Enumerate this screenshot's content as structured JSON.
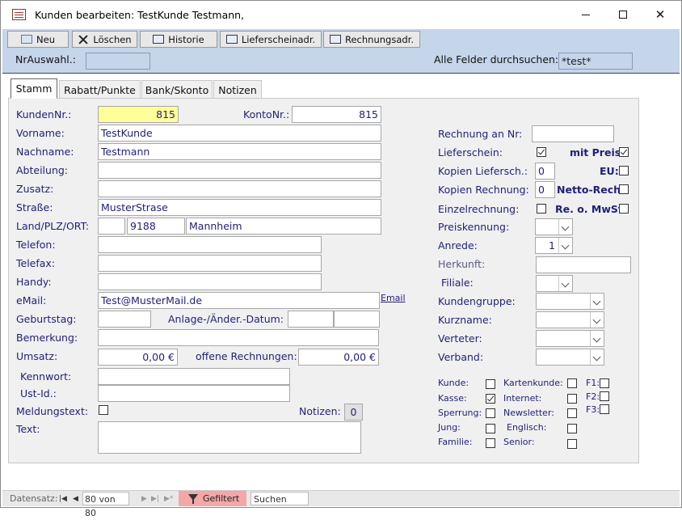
{
  "window": {
    "title": "Kunden bearbeiten: TestKunde Testmann,"
  },
  "toolbar": {
    "neu": "Neu",
    "loeschen": "Löschen",
    "historie": "Historie",
    "lieferscheinadr": "Lieferscheinadr.",
    "rechnungsadr": "Rechnungsadr."
  },
  "header": {
    "nr_auswahl_label": "NrAuswahl.:",
    "nr_auswahl_value": "",
    "search_label": "Alle Felder durchsuchen:",
    "search_value": "*test*"
  },
  "tabs": [
    "Stamm",
    "Rabatt/Punkte",
    "Bank/Skonto",
    "Notizen"
  ],
  "left": {
    "kundennr_label": "KundenNr.:",
    "kundennr": "815",
    "kontonr_label": "KontoNr.:",
    "kontonr": "815",
    "vorname_label": "Vorname:",
    "vorname": "TestKunde",
    "nachname_label": "Nachname:",
    "nachname": "Testmann",
    "abteilung_label": "Abteilung:",
    "abteilung": "",
    "zusatz_label": "Zusatz:",
    "zusatz": "",
    "strasse_label": "Straße:",
    "strasse": "MusterStrase",
    "land_label": "Land/PLZ/ORT:",
    "land": "",
    "plz": "9188",
    "ort": "Mannheim",
    "telefon_label": "Telefon:",
    "telefon": "",
    "telefax_label": "Telefax:",
    "telefax": "",
    "handy_label": "Handy:",
    "handy": "",
    "email_label": "eMail:",
    "email": "Test@MusterMail.de",
    "email_link": "Email",
    "geburtstag_label": "Geburtstag:",
    "geburtstag": "",
    "anlage_label": "Anlage-/Änder.-Datum:",
    "anlage": "",
    "aender": "",
    "bemerkung_label": "Bemerkung:",
    "bemerkung": "",
    "umsatz_label": "Umsatz:",
    "umsatz": "0,00 €",
    "offene_label": "offene Rechnungen:",
    "offene": "0,00 €",
    "kennwort_label": "Kennwort:",
    "kennwort": "",
    "ustid_label": "Ust-Id.:",
    "ustid": "",
    "meldungstext_label": "Meldungstext:",
    "notizen_label": "Notizen:",
    "notizen_count": "0",
    "text_label": "Text:",
    "text": ""
  },
  "right": {
    "rechnung_an_label": "Rechnung an Nr:",
    "rechnung_an": "",
    "lieferschein_label": "Lieferschein:",
    "mit_preis_label": "mit Preis:",
    "eu_label": "EU:",
    "kopien_liefersch_label": "Kopien Liefersch.:",
    "kopien_liefersch": "0",
    "kopien_rechnung_label": "Kopien Rechnung:",
    "kopien_rechnung": "0",
    "netto_label": "Netto-Rech:",
    "einzelrechnung_label": "Einzelrechnung:",
    "reomwst_label": "Re. o. MwSt:",
    "preiskennung_label": "Preiskennung:",
    "preiskennung": "",
    "anrede_label": "Anrede:",
    "anrede": "1",
    "herkunft_label": "Herkunft:",
    "herkunft": "",
    "filiale_label": "Filiale:",
    "filiale": "",
    "kundengruppe_label": "Kundengruppe:",
    "kundengruppe": "",
    "kurzname_label": "Kurzname:",
    "kurzname": "",
    "verteter_label": "Verteter:",
    "verteter": "",
    "verband_label": "Verband:",
    "verband": ""
  },
  "flags": {
    "kunde": "Kunde:",
    "kasse": "Kasse:",
    "sperrung": "Sperrung:",
    "jung": "Jung:",
    "familie": "Familie:",
    "kartenkunde": "Kartenkunde:",
    "internet": "Internet:",
    "newsletter": "Newsletter:",
    "englisch": "Englisch:",
    "senior": "Senior:",
    "f1": "F1:",
    "f2": "F2:",
    "f3": "F3:"
  },
  "checkbox_states": {
    "lieferschein": true,
    "mit_preis": true,
    "eu": false,
    "netto": false,
    "einzelrechnung": false,
    "reomwst": false,
    "meldungstext": false,
    "kunde": false,
    "kasse": true,
    "sperrung": false,
    "jung": false,
    "familie": false,
    "kartenkunde": false,
    "internet": false,
    "newsletter": false,
    "englisch": false,
    "senior": false,
    "f1": false,
    "f2": false,
    "f3": false
  },
  "statusbar": {
    "datensatz_label": "Datensatz:",
    "record": "80 von 80",
    "filter": "Gefiltert",
    "search": "Suchen"
  },
  "icons": {
    "title": "form-icon",
    "neu": "new-record-icon",
    "loeschen": "delete-x-icon",
    "historie": "book-icon",
    "lieferscheinadr": "book-icon",
    "rechnungsadr": "book-icon",
    "filter": "funnel-icon"
  }
}
